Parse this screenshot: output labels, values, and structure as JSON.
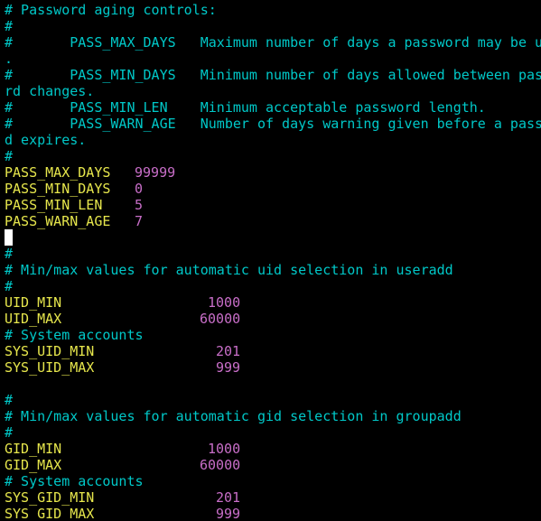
{
  "terminal": {
    "colors": {
      "background": "#000000",
      "comment": "#00c8c8",
      "key": "#e6e64c",
      "value": "#c86ec8",
      "cursor": "#ffffff"
    },
    "lines": [
      {
        "text": "# Password aging controls:"
      },
      {
        "text": "#"
      },
      {
        "text": "#       PASS_MAX_DAYS   Maximum number of days a password may be u"
      },
      {
        "text": "."
      },
      {
        "text": "#       PASS_MIN_DAYS   Minimum number of days allowed between pas"
      },
      {
        "text": "rd changes."
      },
      {
        "text": "#       PASS_MIN_LEN    Minimum acceptable password length."
      },
      {
        "text": "#       PASS_WARN_AGE   Number of days warning given before a pass"
      },
      {
        "text": "d expires."
      },
      {
        "text": "#"
      },
      {
        "key": "PASS_MAX_DAYS",
        "value": "99999"
      },
      {
        "key": "PASS_MIN_DAYS",
        "value": "0"
      },
      {
        "key": "PASS_MIN_LEN",
        "value": "5"
      },
      {
        "key": "PASS_WARN_AGE",
        "value": "7"
      },
      {
        "text": ""
      },
      {
        "text": "#"
      },
      {
        "text": "# Min/max values for automatic uid selection in useradd"
      },
      {
        "text": "#"
      },
      {
        "key": "UID_MIN",
        "value": "1000"
      },
      {
        "key": "UID_MAX",
        "value": "60000"
      },
      {
        "text": "# System accounts"
      },
      {
        "key": "SYS_UID_MIN",
        "value": "201"
      },
      {
        "key": "SYS_UID_MAX",
        "value": "999"
      },
      {
        "text": ""
      },
      {
        "text": "#"
      },
      {
        "text": "# Min/max values for automatic gid selection in groupadd"
      },
      {
        "text": "#"
      },
      {
        "key": "GID_MIN",
        "value": "1000"
      },
      {
        "key": "GID_MAX",
        "value": "60000"
      },
      {
        "text": "# System accounts"
      },
      {
        "key": "SYS_GID_MIN",
        "value": "201"
      },
      {
        "key": "SYS_GID_MAX",
        "value": "999"
      }
    ]
  }
}
